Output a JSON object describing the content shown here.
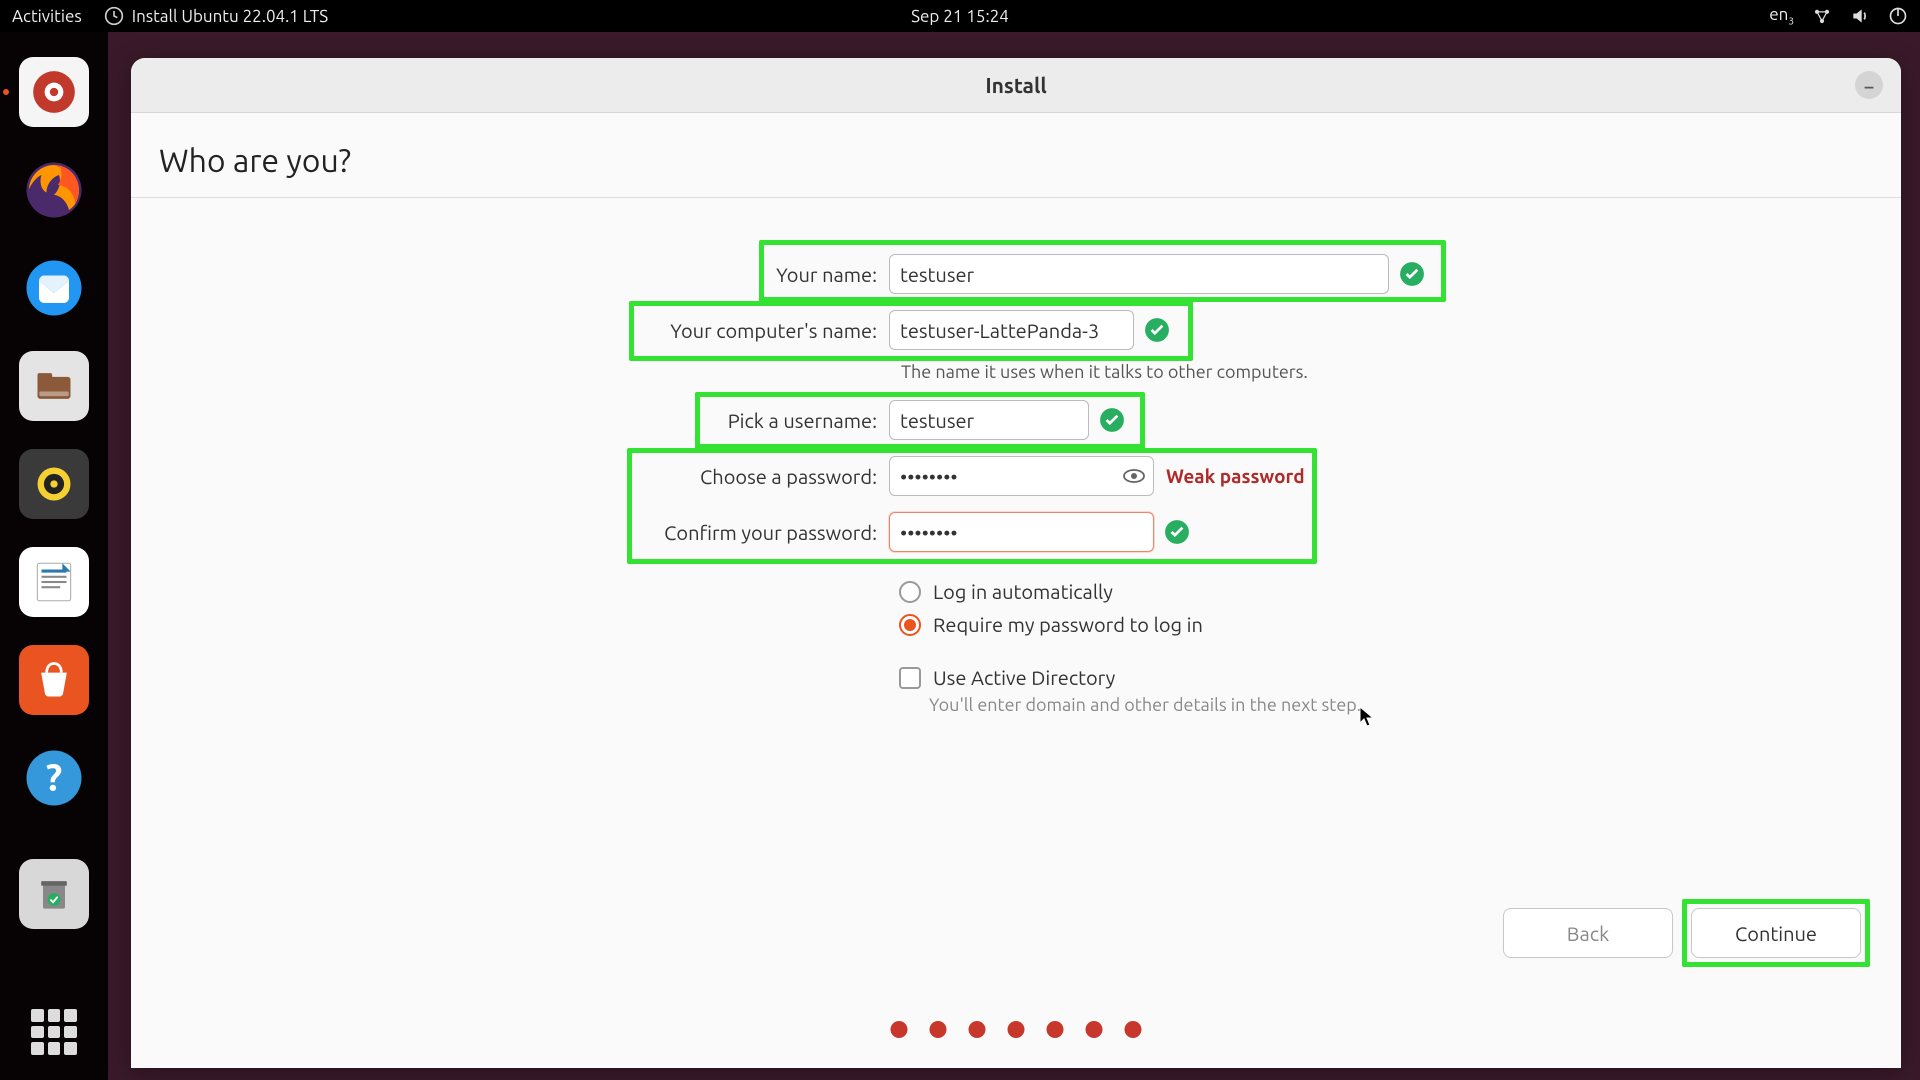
{
  "topbar": {
    "activities": "Activities",
    "app_name": "Install Ubuntu 22.04.1 LTS",
    "datetime": "Sep 21  15:24",
    "lang": "en",
    "lang_sub": "3"
  },
  "dock": [
    {
      "name": "installer",
      "active": true
    },
    {
      "name": "firefox"
    },
    {
      "name": "thunderbird"
    },
    {
      "name": "files"
    },
    {
      "name": "rhythmbox"
    },
    {
      "name": "libreoffice-writer"
    },
    {
      "name": "software"
    },
    {
      "name": "help"
    },
    {
      "name": "trash"
    }
  ],
  "window": {
    "title": "Install",
    "heading": "Who are you?"
  },
  "form": {
    "name_label": "Your name:",
    "name_value": "testuser",
    "hostname_label": "Your computer's name:",
    "hostname_value": "testuser-LattePanda-3",
    "hostname_hint": "The name it uses when it talks to other computers.",
    "username_label": "Pick a username:",
    "username_value": "testuser",
    "password_label": "Choose a password:",
    "password_value": "••••••••",
    "password_strength": "Weak password",
    "confirm_label": "Confirm your password:",
    "confirm_value": "••••••••",
    "login_auto": "Log in automatically",
    "login_pw": "Require my password to log in",
    "ad_label": "Use Active Directory",
    "ad_hint": "You'll enter domain and other details in the next step."
  },
  "buttons": {
    "back": "Back",
    "continue": "Continue"
  },
  "progress": {
    "total": 7
  },
  "colors": {
    "accent": "#e95420",
    "highlight": "#33e233",
    "dot": "#c7372c"
  }
}
